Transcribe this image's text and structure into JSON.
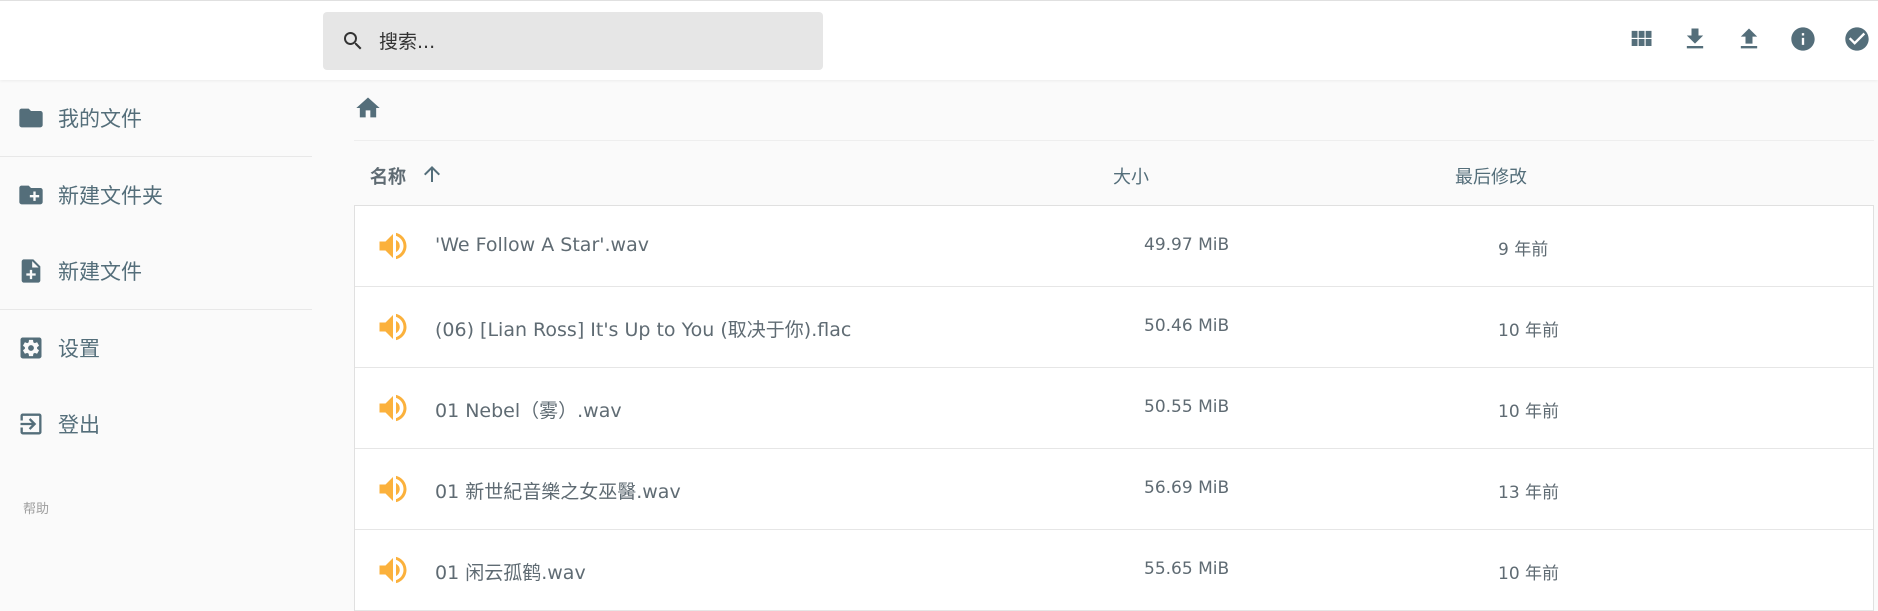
{
  "search": {
    "placeholder": "搜索..."
  },
  "header": {
    "actions": [
      "grid-view",
      "download",
      "upload",
      "info",
      "select"
    ]
  },
  "sidebar": {
    "items": [
      {
        "label": "我的文件",
        "icon": "folder-icon"
      },
      {
        "label": "新建文件夹",
        "icon": "create-folder-icon"
      },
      {
        "label": "新建文件",
        "icon": "note-add-icon"
      },
      {
        "label": "设置",
        "icon": "settings-icon"
      },
      {
        "label": "登出",
        "icon": "exit-icon"
      }
    ],
    "help": "帮助"
  },
  "listing": {
    "columns": {
      "name": "名称",
      "size": "大小",
      "modified": "最后修改"
    },
    "sort": "ascending",
    "rows": [
      {
        "name": "'We Follow A Star'.wav",
        "size": "49.97 MiB",
        "modified": "9 年前",
        "type": "audio"
      },
      {
        "name": "(06) [Lian Ross] It's Up to You (取决于你).flac",
        "size": "50.46 MiB",
        "modified": "10 年前",
        "type": "audio"
      },
      {
        "name": "01 Nebel（雾）.wav",
        "size": "50.55 MiB",
        "modified": "10 年前",
        "type": "audio"
      },
      {
        "name": "01 新世紀音樂之女巫醫.wav",
        "size": "56.69 MiB",
        "modified": "13 年前",
        "type": "audio"
      },
      {
        "name": "01 闲云孤鹤.wav",
        "size": "55.65 MiB",
        "modified": "10 年前",
        "type": "audio"
      }
    ]
  },
  "colors": {
    "accent": "#546e7a",
    "audio_icon": "#fbb13c",
    "search_bg": "#e6e6e6"
  }
}
